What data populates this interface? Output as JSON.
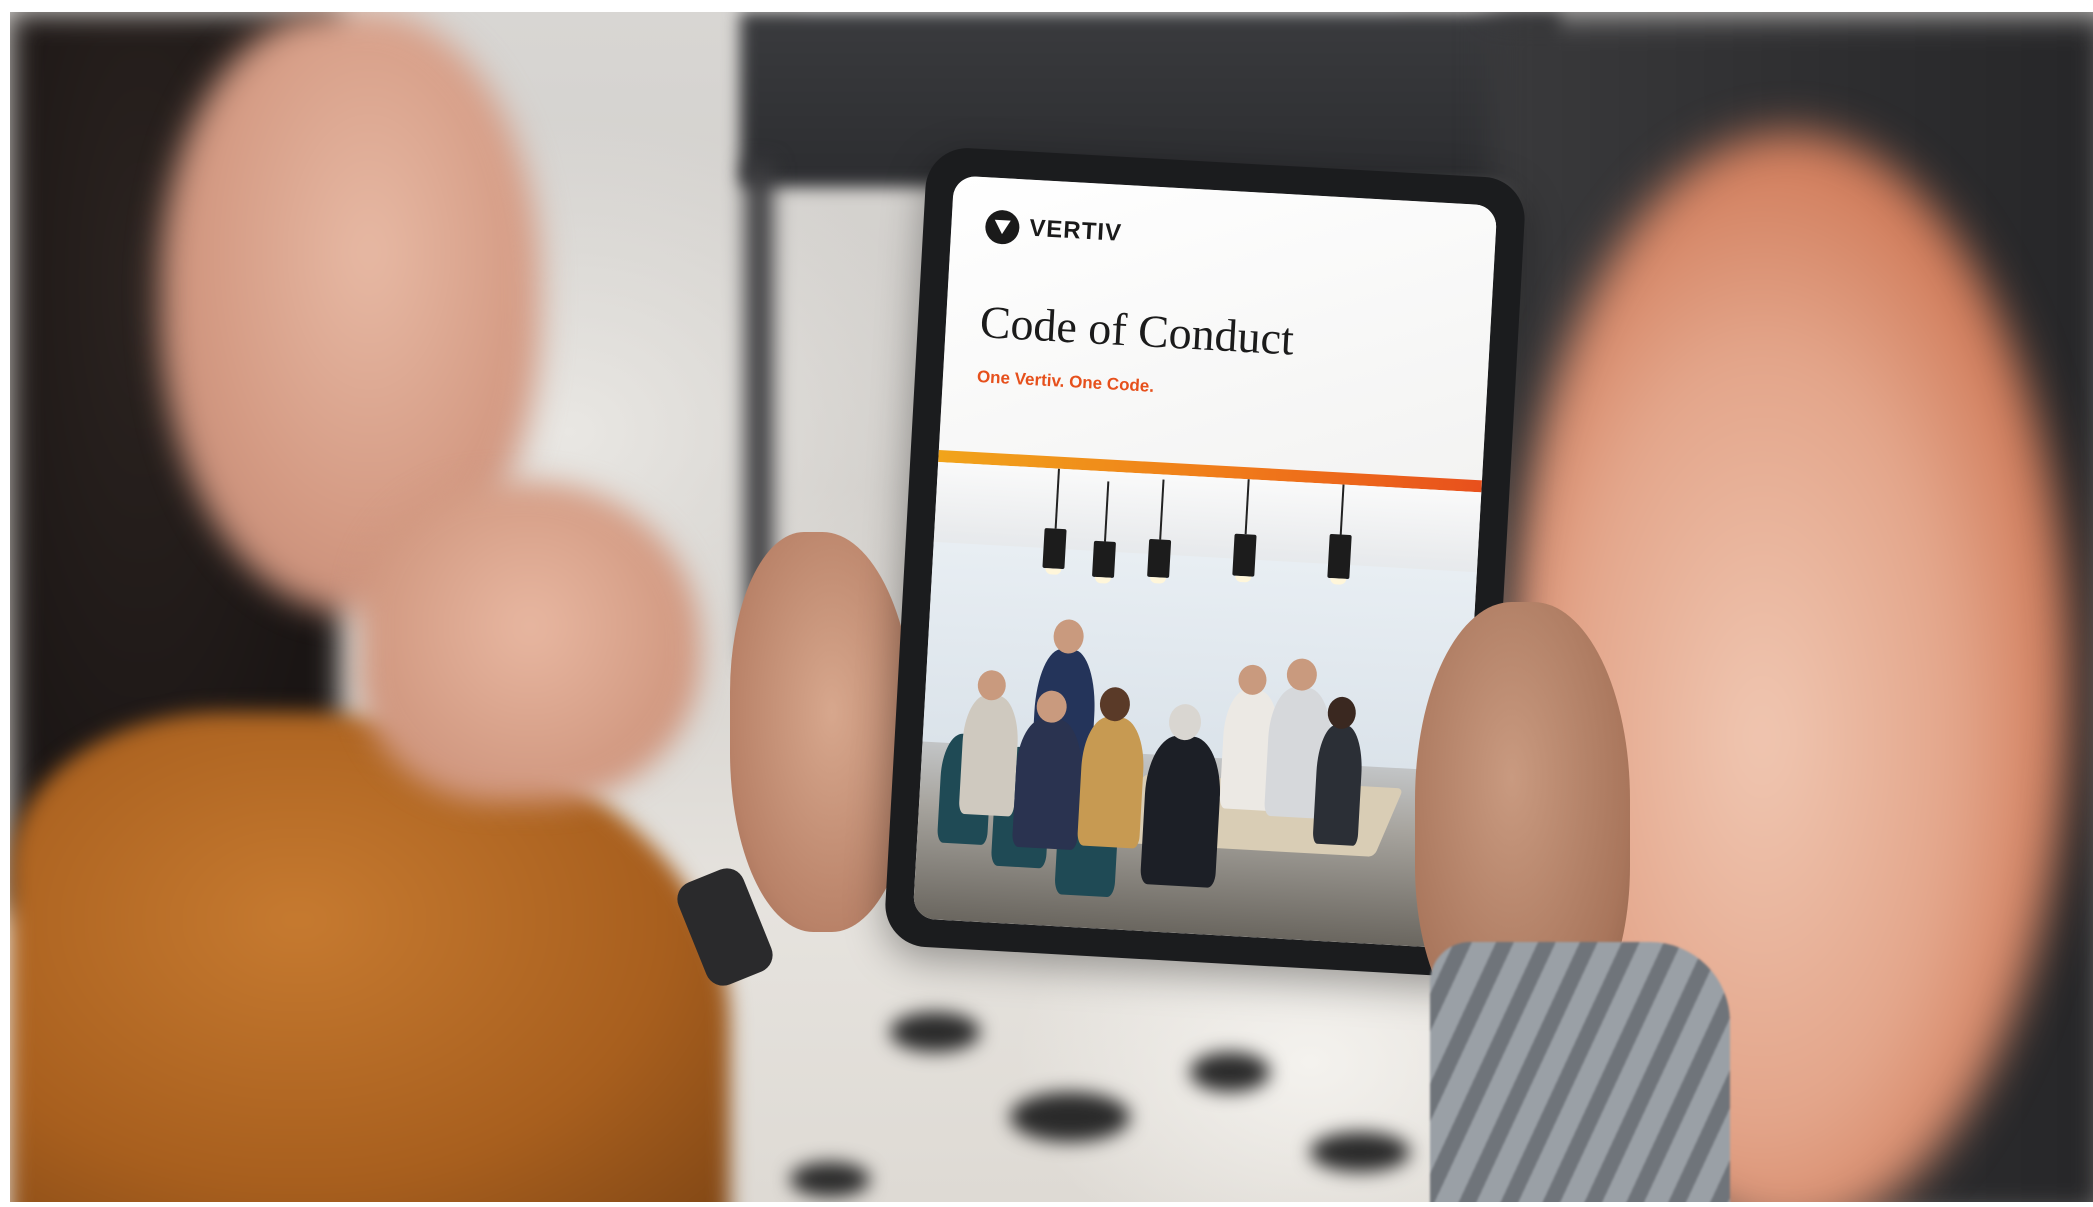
{
  "tablet_screen": {
    "brand": "VERTIV",
    "title": "Code of Conduct",
    "subtitle": "One Vertiv. One Code."
  },
  "colors": {
    "accent_orange": "#e6501c",
    "stripe_yellow": "#f1a41b",
    "sweater": "#b5691f"
  },
  "icons": {
    "brand_logo": "vertiv-logo-icon"
  }
}
